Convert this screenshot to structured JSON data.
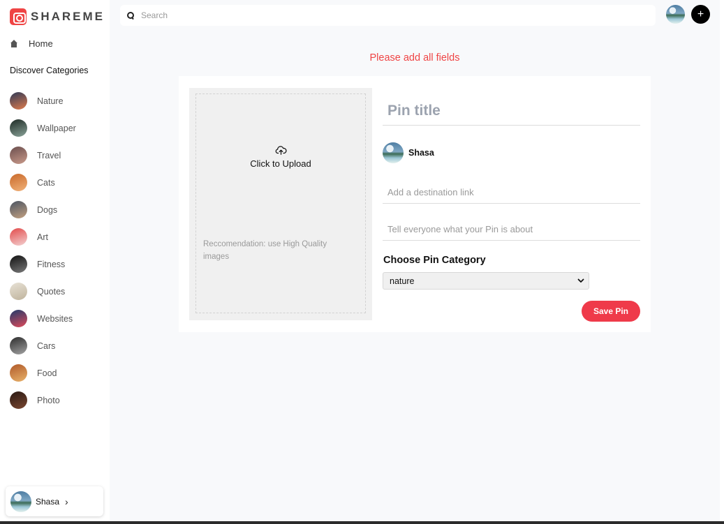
{
  "app": {
    "logo_text": "SHAREME"
  },
  "sidebar": {
    "home_label": "Home",
    "discover_label": "Discover Categories",
    "categories": [
      {
        "label": "Nature",
        "color_a": "#2f3a57",
        "color_b": "#e07b4c"
      },
      {
        "label": "Wallpaper",
        "color_a": "#1d2a24",
        "color_b": "#8aa399"
      },
      {
        "label": "Travel",
        "color_a": "#6b4e4e",
        "color_b": "#c99a8a"
      },
      {
        "label": "Cats",
        "color_a": "#c96a2b",
        "color_b": "#f1b27a"
      },
      {
        "label": "Dogs",
        "color_a": "#4b5563",
        "color_b": "#c3a080"
      },
      {
        "label": "Art",
        "color_a": "#e24a4a",
        "color_b": "#f3d2d2"
      },
      {
        "label": "Fitness",
        "color_a": "#111111",
        "color_b": "#7a7a7a"
      },
      {
        "label": "Quotes",
        "color_a": "#e8e2d6",
        "color_b": "#bfb39c"
      },
      {
        "label": "Websites",
        "color_a": "#1f3a6b",
        "color_b": "#e04a5a"
      },
      {
        "label": "Cars",
        "color_a": "#2c2c2c",
        "color_b": "#a3a3a3"
      },
      {
        "label": "Food",
        "color_a": "#b05a2a",
        "color_b": "#e8b26a"
      },
      {
        "label": "Photo",
        "color_a": "#2a1a14",
        "color_b": "#7a4630"
      }
    ],
    "user": {
      "name": "Shasa",
      "chevron": "›"
    }
  },
  "topbar": {
    "search_placeholder": "Search",
    "add_label": "+"
  },
  "form": {
    "error_message": "Please add all fields",
    "upload_label": "Click to Upload",
    "upload_recommendation": "Reccomendation: use High Quality images",
    "title_placeholder": "Pin title",
    "author_name": "Shasa",
    "link_placeholder": "Add a destination link",
    "about_placeholder": "Tell everyone what your Pin is about",
    "category_heading": "Choose Pin Category",
    "category_selected": "nature",
    "save_label": "Save Pin"
  },
  "colors": {
    "accent": "#ef3a4a",
    "error": "#ef4444"
  }
}
